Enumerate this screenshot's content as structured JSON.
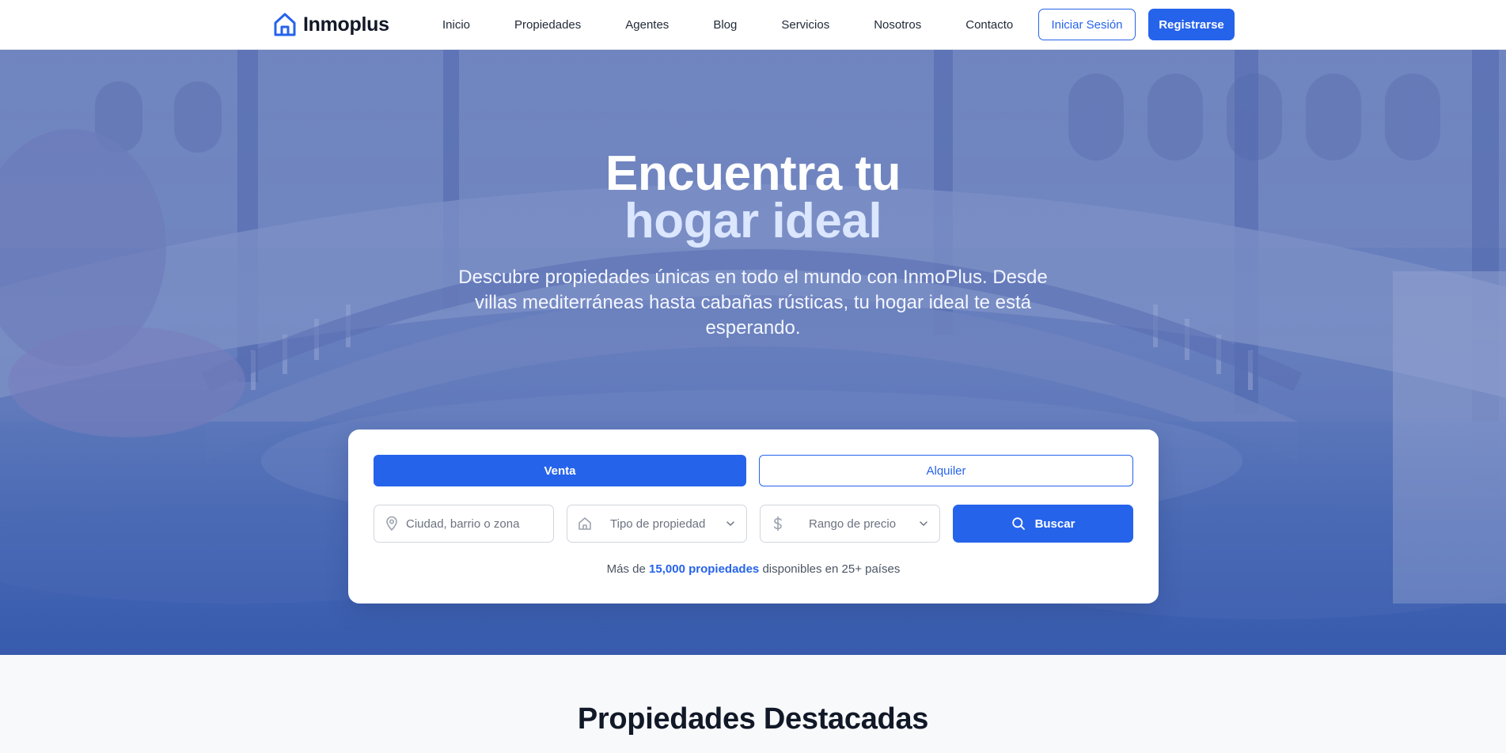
{
  "nav": {
    "brand": "Inmoplus",
    "links": [
      "Inicio",
      "Propiedades",
      "Agentes",
      "Blog",
      "Servicios",
      "Nosotros",
      "Contacto"
    ],
    "login_label": "Iniciar Sesión",
    "register_label": "Registrarse"
  },
  "hero": {
    "title_line1": "Encuentra tu",
    "title_line2": "hogar ideal",
    "subtitle": "Descubre propiedades únicas en todo el mundo con InmoPlus. Desde villas mediterráneas hasta cabañas rústicas, tu hogar ideal te está esperando."
  },
  "search": {
    "tabs": [
      "Venta",
      "Alquiler"
    ],
    "active_tab": "Venta",
    "location_placeholder": "Ciudad, barrio o zona",
    "type_label": "Tipo de propiedad",
    "price_label": "Rango de precio",
    "button_label": "Buscar",
    "stats_prefix": "Más de",
    "stats_highlight": "15,000 propiedades",
    "stats_suffix": "disponibles en 25+ países"
  },
  "featured": {
    "title": "Propiedades Destacadas"
  },
  "colors": {
    "accent": "#2563eb",
    "text_dark": "#111827",
    "hero_overlay": "#3e5caa"
  },
  "icons": [
    "home-icon",
    "map-pin-icon",
    "chevron-down-icon",
    "dollar-icon",
    "search-icon"
  ]
}
